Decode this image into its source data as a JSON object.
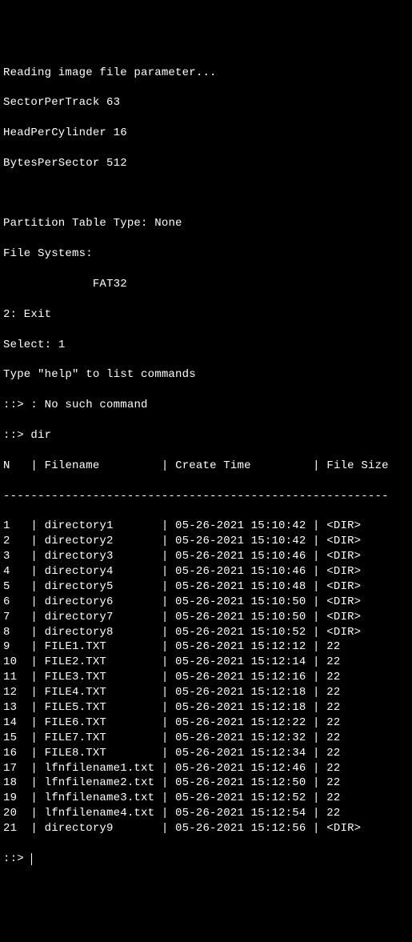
{
  "header": {
    "reading": "Reading image file parameter...",
    "spt_label": "SectorPerTrack",
    "spt_value": "63",
    "hpc_label": "HeadPerCylinder",
    "hpc_value": "16",
    "bps_label": "BytesPerSector",
    "bps_value": "512"
  },
  "partition": {
    "label": "Partition Table Type:",
    "value": "None"
  },
  "fs": {
    "label": "File Systems:",
    "value": "FAT32"
  },
  "menu": {
    "exit": "2: Exit",
    "select_label": "Select:",
    "select_value": "1",
    "help": "Type \"help\" to list commands",
    "nosuch_prompt": "::>",
    "nosuch": ": No such command",
    "dir_prompt": "::>",
    "dir_cmd": "dir"
  },
  "table": {
    "sep": "|",
    "col_n": "N",
    "col_filename": "Filename",
    "col_create": "Create Time",
    "col_size": "File Size",
    "divider": "--------------------------------------------------------",
    "rows": [
      {
        "n": "1",
        "name": "directory1",
        "time": "05-26-2021 15:10:42",
        "size": "<DIR>"
      },
      {
        "n": "2",
        "name": "directory2",
        "time": "05-26-2021 15:10:42",
        "size": "<DIR>"
      },
      {
        "n": "3",
        "name": "directory3",
        "time": "05-26-2021 15:10:46",
        "size": "<DIR>"
      },
      {
        "n": "4",
        "name": "directory4",
        "time": "05-26-2021 15:10:46",
        "size": "<DIR>"
      },
      {
        "n": "5",
        "name": "directory5",
        "time": "05-26-2021 15:10:48",
        "size": "<DIR>"
      },
      {
        "n": "6",
        "name": "directory6",
        "time": "05-26-2021 15:10:50",
        "size": "<DIR>"
      },
      {
        "n": "7",
        "name": "directory7",
        "time": "05-26-2021 15:10:50",
        "size": "<DIR>"
      },
      {
        "n": "8",
        "name": "directory8",
        "time": "05-26-2021 15:10:52",
        "size": "<DIR>"
      },
      {
        "n": "9",
        "name": "FILE1.TXT",
        "time": "05-26-2021 15:12:12",
        "size": "22"
      },
      {
        "n": "10",
        "name": "FILE2.TXT",
        "time": "05-26-2021 15:12:14",
        "size": "22"
      },
      {
        "n": "11",
        "name": "FILE3.TXT",
        "time": "05-26-2021 15:12:16",
        "size": "22"
      },
      {
        "n": "12",
        "name": "FILE4.TXT",
        "time": "05-26-2021 15:12:18",
        "size": "22"
      },
      {
        "n": "13",
        "name": "FILE5.TXT",
        "time": "05-26-2021 15:12:18",
        "size": "22"
      },
      {
        "n": "14",
        "name": "FILE6.TXT",
        "time": "05-26-2021 15:12:22",
        "size": "22"
      },
      {
        "n": "15",
        "name": "FILE7.TXT",
        "time": "05-26-2021 15:12:32",
        "size": "22"
      },
      {
        "n": "16",
        "name": "FILE8.TXT",
        "time": "05-26-2021 15:12:34",
        "size": "22"
      },
      {
        "n": "17",
        "name": "lfnfilename1.txt",
        "time": "05-26-2021 15:12:46",
        "size": "22"
      },
      {
        "n": "18",
        "name": "lfnfilename2.txt",
        "time": "05-26-2021 15:12:50",
        "size": "22"
      },
      {
        "n": "19",
        "name": "lfnfilename3.txt",
        "time": "05-26-2021 15:12:52",
        "size": "22"
      },
      {
        "n": "20",
        "name": "lfnfilename4.txt",
        "time": "05-26-2021 15:12:54",
        "size": "22"
      },
      {
        "n": "21",
        "name": "directory9",
        "time": "05-26-2021 15:12:56",
        "size": "<DIR>"
      }
    ]
  },
  "prompt": {
    "text": "::>"
  }
}
